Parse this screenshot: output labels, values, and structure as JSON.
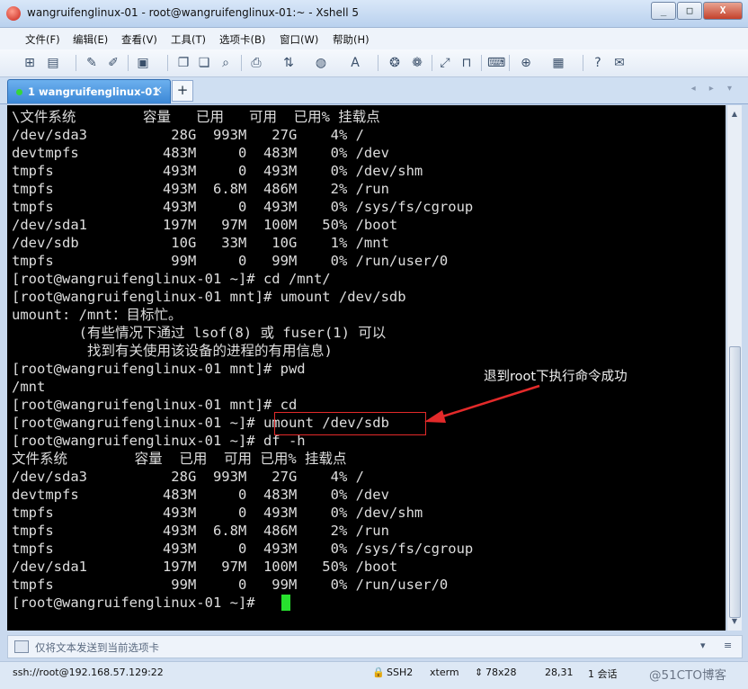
{
  "window": {
    "title": "wangruifenglinux-01 - root@wangruifenglinux-01:~ - Xshell 5",
    "controls": [
      "_",
      "□",
      "X"
    ]
  },
  "menu": [
    "文件(F)",
    "编辑(E)",
    "查看(V)",
    "工具(T)",
    "选项卡(B)",
    "窗口(W)",
    "帮助(H)"
  ],
  "tab": {
    "label": "1 wangruifenglinux-01",
    "close": "×",
    "add": "+",
    "nav": "◂ ▸ ▾"
  },
  "terminal": {
    "lines": [
      "\\文件系统        容量   已用   可用  已用% 挂载点",
      "/dev/sda3          28G  993M   27G    4% /",
      "devtmpfs          483M     0  483M    0% /dev",
      "tmpfs             493M     0  493M    0% /dev/shm",
      "tmpfs             493M  6.8M  486M    2% /run",
      "tmpfs             493M     0  493M    0% /sys/fs/cgroup",
      "/dev/sda1         197M   97M  100M   50% /boot",
      "/dev/sdb           10G   33M   10G    1% /mnt",
      "tmpfs              99M     0   99M    0% /run/user/0",
      "[root@wangruifenglinux-01 ~]# cd /mnt/",
      "[root@wangruifenglinux-01 mnt]# umount /dev/sdb",
      "umount: /mnt：目标忙。",
      "        (有些情况下通过 lsof(8) 或 fuser(1) 可以",
      "         找到有关使用该设备的进程的有用信息)",
      "[root@wangruifenglinux-01 mnt]# pwd",
      "/mnt",
      "[root@wangruifenglinux-01 mnt]# cd",
      "[root@wangruifenglinux-01 ~]# umount /dev/sdb",
      "[root@wangruifenglinux-01 ~]# df -h",
      "文件系统        容量  已用  可用 已用% 挂载点",
      "/dev/sda3          28G  993M   27G    4% /",
      "devtmpfs          483M     0  483M    0% /dev",
      "tmpfs             493M     0  493M    0% /dev/shm",
      "tmpfs             493M  6.8M  486M    2% /run",
      "tmpfs             493M     0  493M    0% /sys/fs/cgroup",
      "/dev/sda1         197M   97M  100M   50% /boot",
      "tmpfs              99M     0   99M    0% /run/user/0",
      "[root@wangruifenglinux-01 ~]# "
    ],
    "annotation": "退到root下执行命令成功",
    "cursor_color": "#27e12e",
    "annotation_color": "#e32a2a"
  },
  "send_bar": {
    "placeholder": "仅将文本发送到当前选项卡",
    "right_icons": [
      "▾",
      "≡"
    ]
  },
  "status": {
    "connection": "ssh://root@192.168.57.129:22",
    "protocol": "SSH2",
    "terminal_type": "xterm",
    "size": "78x28",
    "cursor_pos": "28,31",
    "sessions": "1 会话",
    "watermark": "@51CTO博客"
  }
}
